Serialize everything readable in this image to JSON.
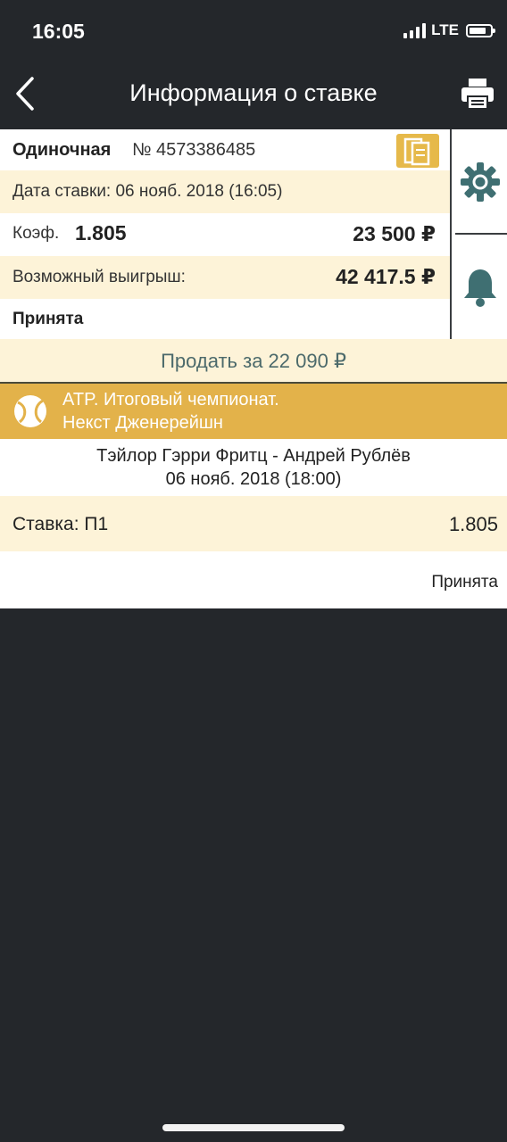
{
  "status_bar": {
    "time": "16:05",
    "network": "LTE"
  },
  "nav": {
    "title": "Информация о ставке",
    "back_icon": "chevron-left-icon",
    "print_icon": "printer-icon"
  },
  "bet": {
    "type": "Одиночная",
    "number": "№ 4573386485",
    "date": "Дата ставки: 06 нояб. 2018 (16:05)",
    "coef_label": "Коэф.",
    "coef_value": "1.805",
    "stake": "23 500 ₽",
    "win_label": "Возможный выигрыш:",
    "win_value": "42 417.5 ₽",
    "status": "Принята"
  },
  "side_actions": {
    "settings_icon": "gear-icon",
    "notify_icon": "bell-icon"
  },
  "sell": {
    "label": "Продать за 22 090 ₽"
  },
  "event": {
    "icon": "tennis-ball-icon",
    "tournament_line1": "ATP. Итоговый чемпионат.",
    "tournament_line2": "Некст Дженерейшн",
    "match": "Тэйлор Гэрри Фритц - Андрей Рублёв",
    "match_date": "06 нояб. 2018 (18:00)",
    "stake_label": "Ставка: П1",
    "stake_coef": "1.805",
    "result_status": "Принята"
  },
  "colors": {
    "background": "#24272b",
    "accent": "#e3b24a",
    "highlight_row": "#fdf3d8",
    "sell_text": "#4c6a6b"
  }
}
